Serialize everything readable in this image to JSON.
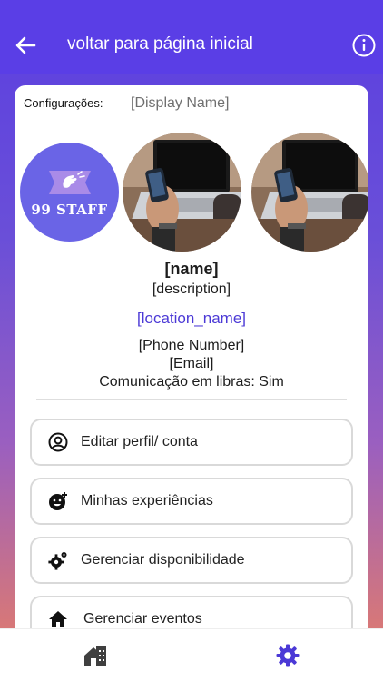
{
  "header": {
    "title": "voltar para página inicial",
    "back_icon": "arrow-left-icon",
    "info_icon": "info-circle-icon"
  },
  "profile": {
    "settings_label": "Configurações:",
    "display_name": "[Display Name]",
    "logo_text": "99 STAFF",
    "name": "[name]",
    "description": "[description]",
    "location": "[location_name]",
    "phone": "[Phone Number]",
    "email": "[Email]",
    "libras": "Comunicação em libras: Sim"
  },
  "menu": [
    {
      "label": "Editar perfil/ conta",
      "icon": "user-circle-icon"
    },
    {
      "label": "Minhas experiências",
      "icon": "smile-plus-icon"
    },
    {
      "label": "Gerenciar disponibilidade",
      "icon": "gears-icon"
    },
    {
      "label": "Gerenciar eventos",
      "icon": "home-icon"
    }
  ],
  "bottom_nav": {
    "home_icon": "house-building-icon",
    "settings_icon": "gear-icon"
  },
  "colors": {
    "appbar": "#5a3ee6",
    "accent": "#4b39d6",
    "logo_bg": "#6a64e6"
  }
}
